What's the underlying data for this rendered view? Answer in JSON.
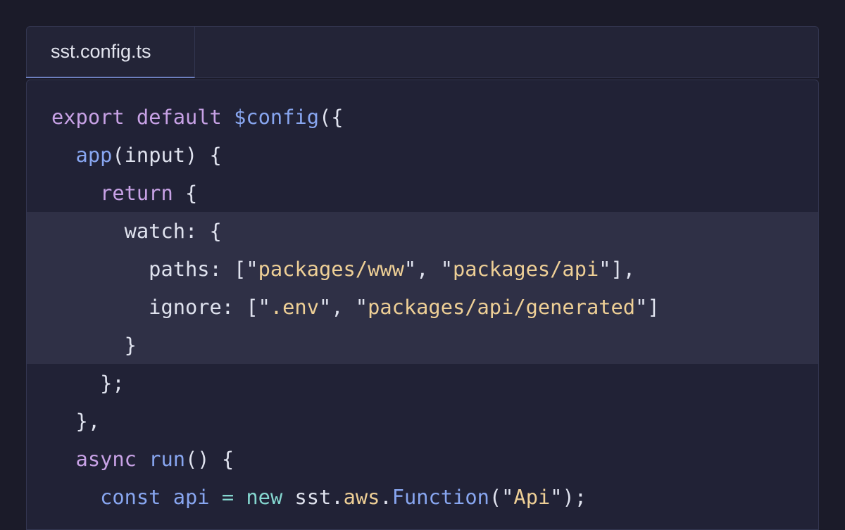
{
  "file_tab": {
    "label": "sst.config.ts"
  },
  "colors": {
    "page_background": "#1b1b29",
    "editor_background": "#212236",
    "highlight_background": "#2f3046",
    "keyword": "#c8a2e6",
    "function": "#88a6f0",
    "string": "#eecf96",
    "operator": "#85d7d0",
    "plain_text": "#dfe2ee"
  },
  "code": {
    "lines": [
      {
        "highlighted": false,
        "tokens": [
          {
            "text": "export",
            "kind": "kw"
          },
          {
            "text": " ",
            "kind": "txt"
          },
          {
            "text": "default",
            "kind": "kw"
          },
          {
            "text": " ",
            "kind": "txt"
          },
          {
            "text": "$config",
            "kind": "fn"
          },
          {
            "text": "({",
            "kind": "txt"
          }
        ]
      },
      {
        "highlighted": false,
        "tokens": [
          {
            "text": "  ",
            "kind": "txt"
          },
          {
            "text": "app",
            "kind": "fn"
          },
          {
            "text": "(input) {",
            "kind": "txt"
          }
        ]
      },
      {
        "highlighted": false,
        "tokens": [
          {
            "text": "    ",
            "kind": "txt"
          },
          {
            "text": "return",
            "kind": "kw"
          },
          {
            "text": " {",
            "kind": "txt"
          }
        ]
      },
      {
        "highlighted": true,
        "tokens": [
          {
            "text": "      watch: {",
            "kind": "txt"
          }
        ]
      },
      {
        "highlighted": true,
        "tokens": [
          {
            "text": "        paths: [\"",
            "kind": "txt"
          },
          {
            "text": "packages/www",
            "kind": "str"
          },
          {
            "text": "\", \"",
            "kind": "txt"
          },
          {
            "text": "packages/api",
            "kind": "str"
          },
          {
            "text": "\"],",
            "kind": "txt"
          }
        ]
      },
      {
        "highlighted": true,
        "tokens": [
          {
            "text": "        ignore: [\"",
            "kind": "txt"
          },
          {
            "text": ".env",
            "kind": "str"
          },
          {
            "text": "\", \"",
            "kind": "txt"
          },
          {
            "text": "packages/api/generated",
            "kind": "str"
          },
          {
            "text": "\"]",
            "kind": "txt"
          }
        ]
      },
      {
        "highlighted": true,
        "tokens": [
          {
            "text": "      }",
            "kind": "txt"
          }
        ]
      },
      {
        "highlighted": false,
        "tokens": [
          {
            "text": "    };",
            "kind": "txt"
          }
        ]
      },
      {
        "highlighted": false,
        "tokens": [
          {
            "text": "  },",
            "kind": "txt"
          }
        ]
      },
      {
        "highlighted": false,
        "tokens": [
          {
            "text": "  ",
            "kind": "txt"
          },
          {
            "text": "async",
            "kind": "kw"
          },
          {
            "text": " ",
            "kind": "txt"
          },
          {
            "text": "run",
            "kind": "fn"
          },
          {
            "text": "() {",
            "kind": "txt"
          }
        ]
      },
      {
        "highlighted": false,
        "tokens": [
          {
            "text": "    ",
            "kind": "txt"
          },
          {
            "text": "const",
            "kind": "fn"
          },
          {
            "text": " ",
            "kind": "txt"
          },
          {
            "text": "api",
            "kind": "fn"
          },
          {
            "text": " ",
            "kind": "txt"
          },
          {
            "text": "=",
            "kind": "op"
          },
          {
            "text": " ",
            "kind": "txt"
          },
          {
            "text": "new",
            "kind": "op"
          },
          {
            "text": " sst.",
            "kind": "txt"
          },
          {
            "text": "aws",
            "kind": "str"
          },
          {
            "text": ".",
            "kind": "txt"
          },
          {
            "text": "Function",
            "kind": "fn"
          },
          {
            "text": "(\"",
            "kind": "txt"
          },
          {
            "text": "Api",
            "kind": "str"
          },
          {
            "text": "\");",
            "kind": "txt"
          }
        ]
      }
    ]
  }
}
